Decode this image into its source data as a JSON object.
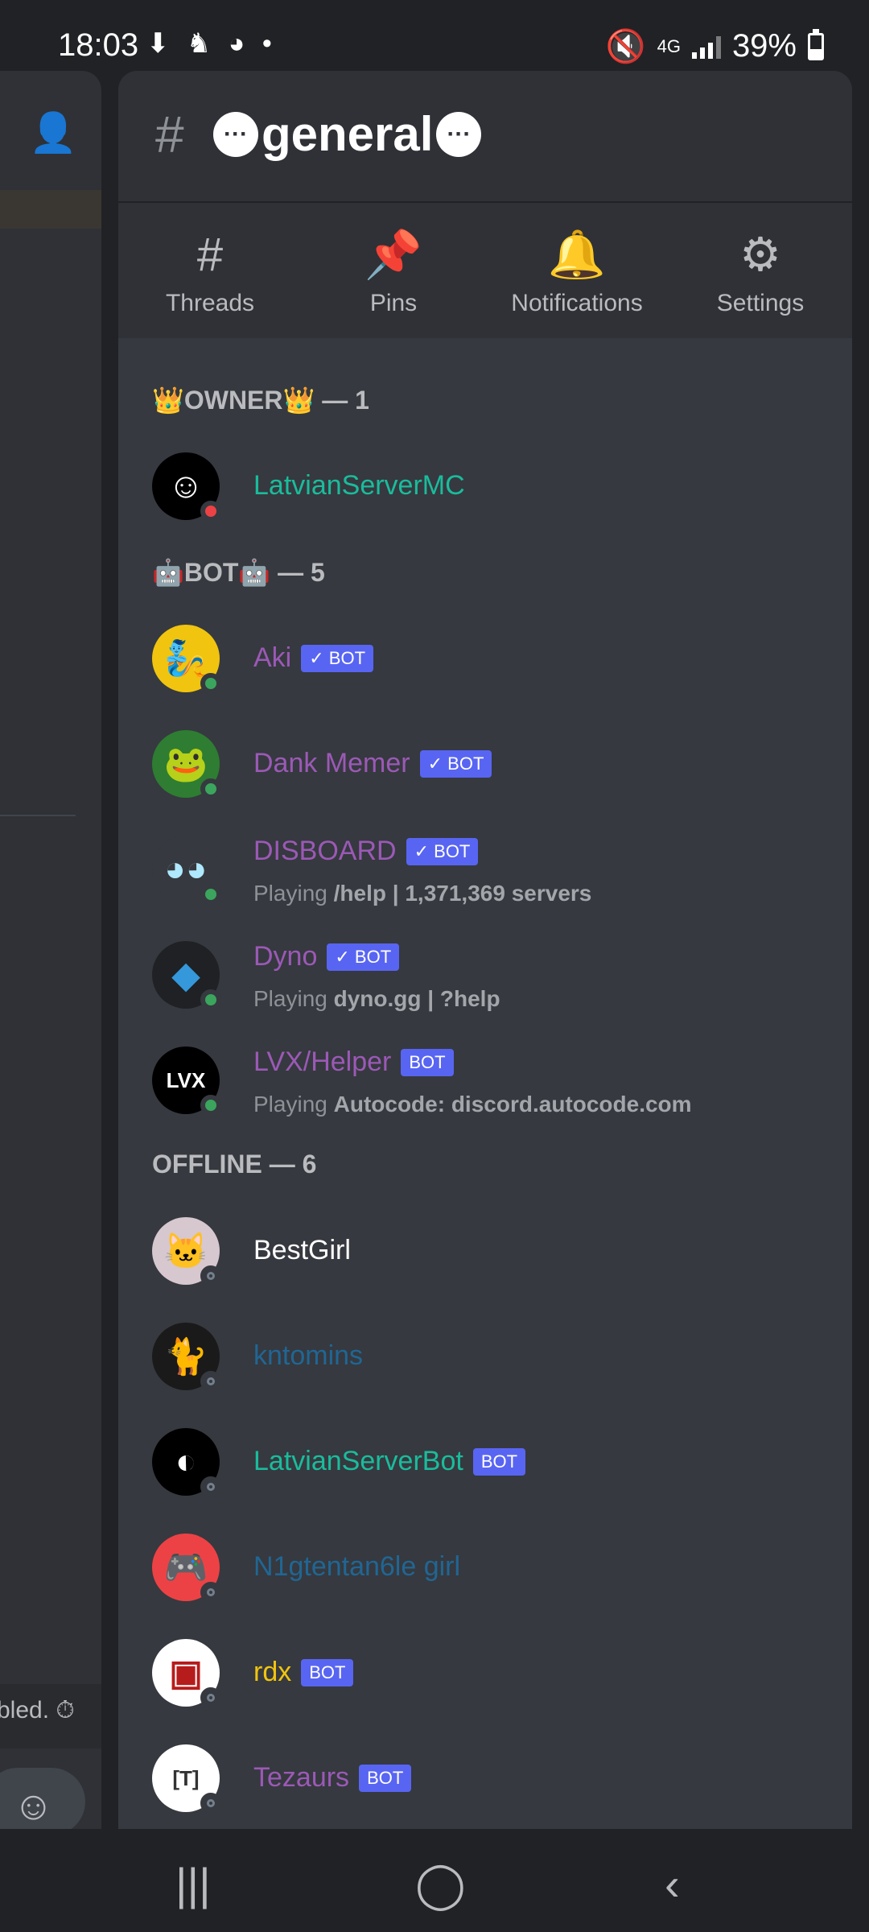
{
  "status_bar": {
    "time": "18:03",
    "left_icons": "⬇ ♞ ◕ •",
    "network": "4G",
    "battery": "39%",
    "battery_level": 0.39
  },
  "background_chat": {
    "slowmode_text": "bled. ⏱"
  },
  "channel": {
    "name": "general"
  },
  "tabs": [
    {
      "label": "Threads",
      "icon": "threads-icon"
    },
    {
      "label": "Pins",
      "icon": "pin-icon"
    },
    {
      "label": "Notifications",
      "icon": "bell-icon"
    },
    {
      "label": "Settings",
      "icon": "gear-icon"
    }
  ],
  "sections": [
    {
      "title": "👑OWNER👑 — 1"
    },
    {
      "title": "🤖BOT🤖 — 5"
    },
    {
      "title": "OFFLINE — 6"
    }
  ],
  "members": [
    {
      "name": "LatvianServerMC",
      "color": "#1abc9c",
      "status": "dnd",
      "avatar_bg": "#000000",
      "avatar_glyph": "☺",
      "avatar_color": "#ffffff"
    },
    {
      "name": "Aki",
      "color": "#9b59b6",
      "tag": "✓ BOT",
      "status": "online",
      "avatar_bg": "#f1c40f",
      "avatar_glyph": "🧞",
      "avatar_color": "#1f4fa3"
    },
    {
      "name": "Dank Memer",
      "color": "#9b59b6",
      "tag": "✓ BOT",
      "status": "online",
      "avatar_bg": "#2e7d32",
      "avatar_glyph": "🐸",
      "avatar_color": "#ffffff"
    },
    {
      "name": "DISBOARD",
      "color": "#9b59b6",
      "tag": "✓ BOT",
      "status": "online",
      "activity_prefix": "Playing",
      "activity": "/help | 1,371,369 servers",
      "avatar_bg": "#36393f",
      "avatar_glyph": "◕◕",
      "avatar_color": "#aee9ff"
    },
    {
      "name": "Dyno",
      "color": "#9b59b6",
      "tag": "✓ BOT",
      "status": "online",
      "activity_prefix": "Playing",
      "activity": "dyno.gg | ?help",
      "avatar_bg": "#1f2124",
      "avatar_glyph": "◆",
      "avatar_color": "#3498db"
    },
    {
      "name": "LVX/Helper",
      "color": "#9b59b6",
      "tag": "BOT",
      "status": "online",
      "activity_prefix": "Playing",
      "activity": "Autocode: discord.autocode.com",
      "avatar_bg": "#000000",
      "avatar_glyph": "LVX",
      "avatar_color": "#ffffff"
    },
    {
      "name": "BestGirl",
      "color": "#ffffff",
      "status": "offline",
      "avatar_bg": "#d7c7cf",
      "avatar_glyph": "🐱",
      "avatar_color": "#ffffff"
    },
    {
      "name": "kntomins",
      "color": "#206694",
      "status": "offline",
      "avatar_bg": "#1a1a1a",
      "avatar_glyph": "🐈",
      "avatar_color": "#3ba55d"
    },
    {
      "name": "LatvianServerBot",
      "color": "#1abc9c",
      "tag": "BOT",
      "status": "offline",
      "avatar_bg": "#000000",
      "avatar_glyph": "◐",
      "avatar_color": "#ffffff"
    },
    {
      "name": "N1gtentan6le girl",
      "color": "#206694",
      "status": "offline",
      "avatar_bg": "#ed4245",
      "avatar_glyph": "🎮",
      "avatar_color": "#ffffff"
    },
    {
      "name": "rdx",
      "color": "#f1c40f",
      "tag": "BOT",
      "status": "offline",
      "avatar_bg": "#ffffff",
      "avatar_glyph": "▣",
      "avatar_color": "#b71c1c"
    },
    {
      "name": "Tezaurs",
      "color": "#9b59b6",
      "tag": "BOT",
      "status": "offline",
      "avatar_bg": "#ffffff",
      "avatar_glyph": "[T]",
      "avatar_color": "#333333"
    }
  ]
}
